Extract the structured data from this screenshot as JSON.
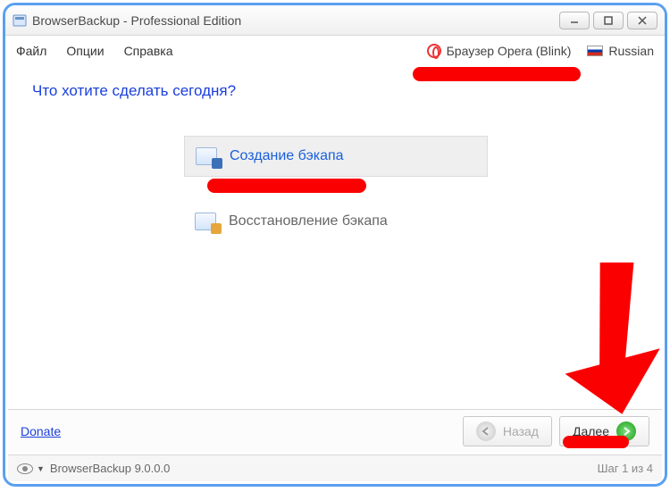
{
  "window": {
    "title": "BrowserBackup - Professional Edition"
  },
  "menubar": {
    "file": "Файл",
    "options": "Опции",
    "help": "Справка",
    "browser_label": "Браузер Opera (Blink)",
    "language_label": "Russian"
  },
  "main": {
    "heading": "Что хотите сделать сегодня?",
    "create_label": "Создание бэкапа",
    "restore_label": "Восстановление бэкапа"
  },
  "footer": {
    "donate": "Donate",
    "back": "Назад",
    "next": "Далее"
  },
  "statusbar": {
    "app": "BrowserBackup 9.0.0.0",
    "step": "Шаг 1 из 4"
  },
  "colors": {
    "annotation": "#fb0000",
    "link": "#1a3fdc"
  }
}
